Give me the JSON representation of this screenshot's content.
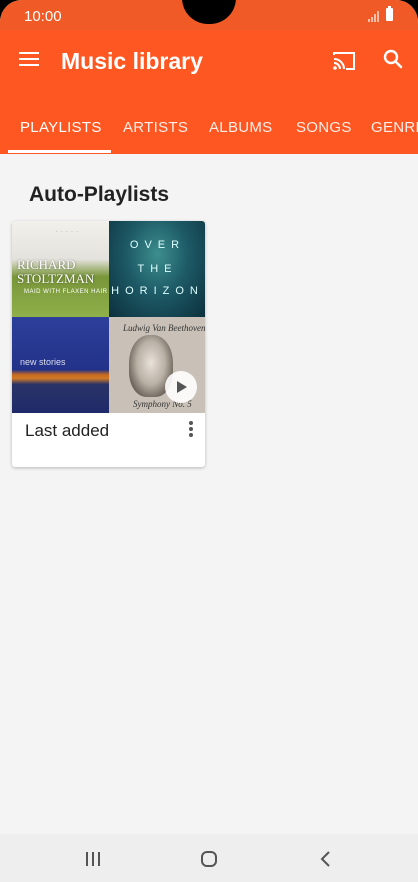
{
  "status": {
    "time": "10:00"
  },
  "appbar": {
    "title": "Music library"
  },
  "tabs": [
    {
      "label": "PLAYLISTS"
    },
    {
      "label": "ARTISTS"
    },
    {
      "label": "ALBUMS"
    },
    {
      "label": "SONGS"
    },
    {
      "label": "GENRES"
    }
  ],
  "section": {
    "title": "Auto-Playlists"
  },
  "playlist_card": {
    "label": "Last added",
    "covers": [
      {
        "lines": [
          "RICHARD",
          "STOLTZMAN"
        ],
        "sub": "MAID WITH FLAXEN HAIR"
      },
      {
        "lines": [
          "OVER",
          "THE",
          "HORIZON"
        ]
      },
      {
        "lines": [
          "new stories"
        ]
      },
      {
        "lines": [
          "Ludwig Van Beethoven",
          "Symphony No. 5"
        ]
      }
    ]
  },
  "colors": {
    "accent": "#ff5722",
    "status_bar": "#ef5a26",
    "background": "#f4f4f4"
  }
}
